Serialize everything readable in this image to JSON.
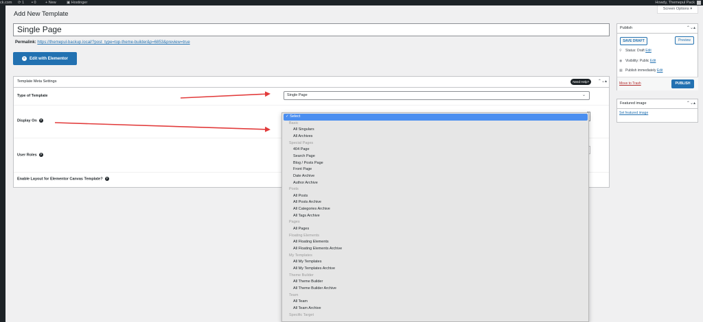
{
  "adminbar": {
    "site": "ck.com",
    "updates": "1",
    "comments": "0",
    "new": "+ New",
    "hostinger": "Hostinger",
    "howdy": "Howdy, Themepul Pack"
  },
  "screen_options": "Screen Options ▾",
  "page_title": "Add New Template",
  "title_value": "Single Page",
  "permalink": {
    "label": "Permalink:",
    "url": "https://themepul-backup.local/?post_type=top-theme-builder&p=6853&preview=true"
  },
  "elementor_button": "Edit with Elementor",
  "metabox": {
    "title": "Template Meta Settings",
    "need_help": "Need Help?",
    "rows": [
      {
        "label": "Type of Template"
      },
      {
        "label": "Display On"
      },
      {
        "label": "User Roles"
      },
      {
        "label": "Enable Layout for Elementor Canvas Template?"
      }
    ],
    "type_select_value": "Single Page"
  },
  "dropdown": {
    "items": [
      {
        "kind": "selected",
        "text": "✓ Select"
      },
      {
        "kind": "group",
        "text": "Basic"
      },
      {
        "kind": "opt",
        "text": "All Singulars"
      },
      {
        "kind": "opt",
        "text": "All Archives"
      },
      {
        "kind": "group",
        "text": "Special Pages"
      },
      {
        "kind": "opt",
        "text": "404 Page"
      },
      {
        "kind": "opt",
        "text": "Search Page"
      },
      {
        "kind": "opt",
        "text": "Blog / Posts Page"
      },
      {
        "kind": "opt",
        "text": "Front Page"
      },
      {
        "kind": "opt",
        "text": "Date Archive"
      },
      {
        "kind": "opt",
        "text": "Author Archive"
      },
      {
        "kind": "group",
        "text": "Posts"
      },
      {
        "kind": "opt",
        "text": "All Posts"
      },
      {
        "kind": "opt",
        "text": "All Posts Archive"
      },
      {
        "kind": "opt",
        "text": "All Categories Archive"
      },
      {
        "kind": "opt",
        "text": "All Tags Archive"
      },
      {
        "kind": "group",
        "text": "Pages"
      },
      {
        "kind": "opt",
        "text": "All Pages"
      },
      {
        "kind": "group",
        "text": "Floating Elements"
      },
      {
        "kind": "opt",
        "text": "All Floating Elements"
      },
      {
        "kind": "opt",
        "text": "All Floating Elements Archive"
      },
      {
        "kind": "group",
        "text": "My Templates"
      },
      {
        "kind": "opt",
        "text": "All My Templates"
      },
      {
        "kind": "opt",
        "text": "All My Templates Archive"
      },
      {
        "kind": "group",
        "text": "Theme Builder"
      },
      {
        "kind": "opt",
        "text": "All Theme Builder"
      },
      {
        "kind": "opt",
        "text": "All Theme Builder Archive"
      },
      {
        "kind": "group",
        "text": "Team"
      },
      {
        "kind": "opt",
        "text": "All Team"
      },
      {
        "kind": "opt",
        "text": "All Team Archive"
      },
      {
        "kind": "group",
        "text": "Specific Target"
      }
    ]
  },
  "publish_box": {
    "title": "Publish",
    "save_draft": "SAVE DRAFT",
    "preview": "Preview",
    "status_label": "Status: Draft",
    "visibility_label": "Visibility: Public",
    "publish_label": "Publish immediately",
    "edit": "Edit",
    "trash": "Move to Trash",
    "publish": "PUBLISH"
  },
  "featured_box": {
    "title": "Featured image",
    "link": "Set featured image"
  },
  "colors": {
    "accent": "#2271b1",
    "arrow": "#e23b3b",
    "selected": "#4a8ef0"
  }
}
